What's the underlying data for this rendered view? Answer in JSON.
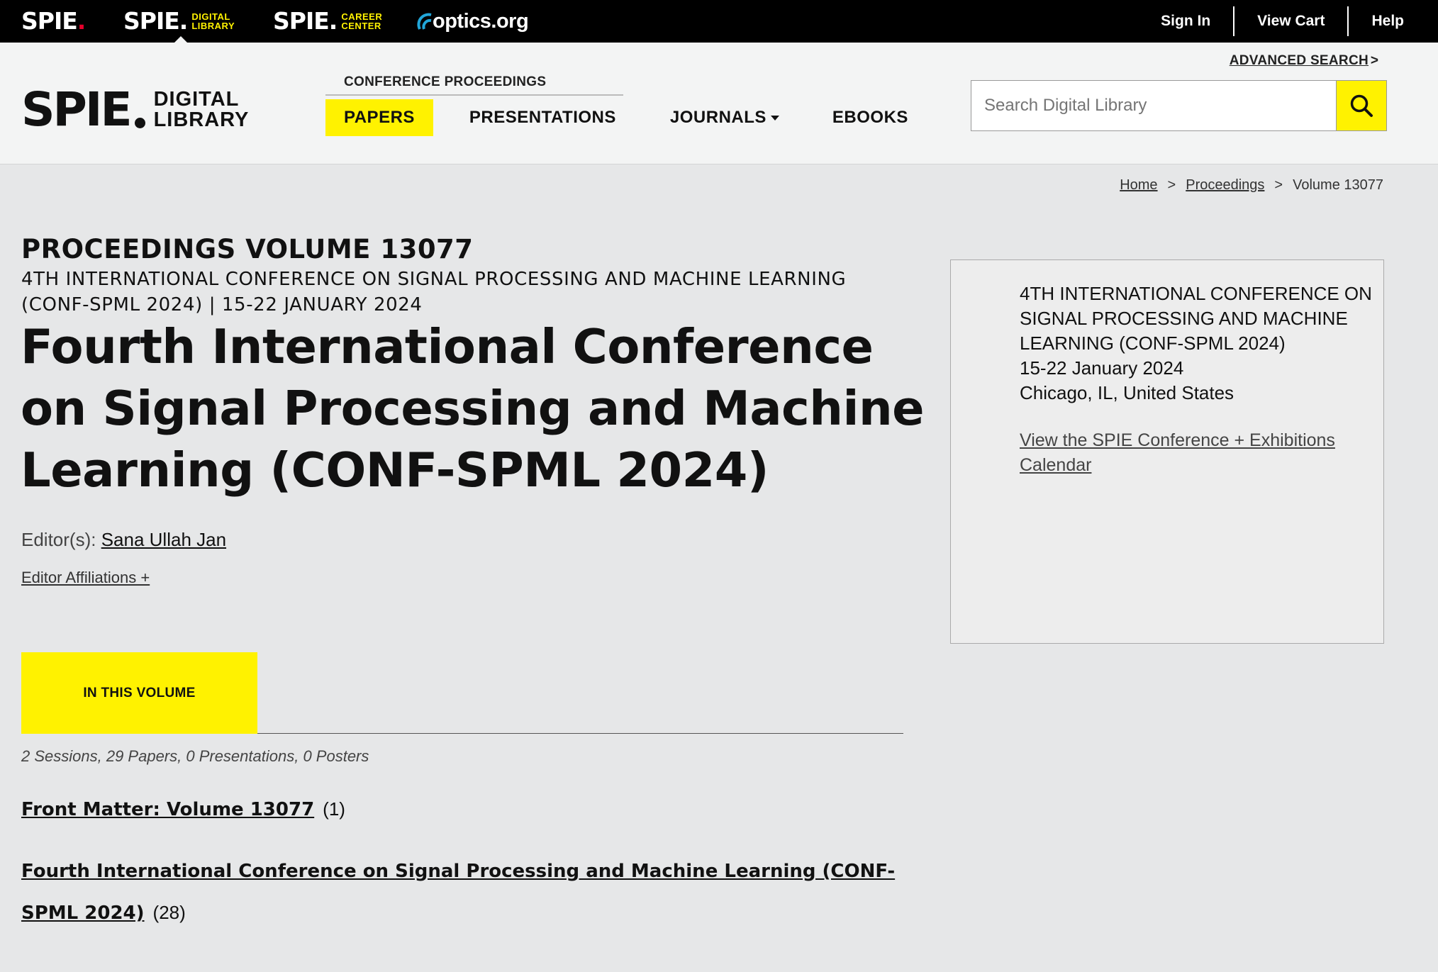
{
  "topbar": {
    "brand_spie": "SPIE",
    "brand_dl": "SPIE",
    "brand_dl_sub": [
      "DIGITAL",
      "LIBRARY"
    ],
    "brand_cc": "SPIE",
    "brand_cc_sub": [
      "CAREER",
      "CENTER"
    ],
    "optics": "optics.org",
    "links": [
      "Sign In",
      "View Cart",
      "Help"
    ]
  },
  "header": {
    "logo_word": "SPIE",
    "logo_sub": [
      "DIGITAL",
      "LIBRARY"
    ],
    "section_label": "CONFERENCE PROCEEDINGS",
    "tabs": [
      "PAPERS",
      "PRESENTATIONS",
      "JOURNALS",
      "EBOOKS"
    ],
    "advanced_search": "ADVANCED SEARCH",
    "advanced_search_gt": ">",
    "search_placeholder": "Search Digital Library"
  },
  "breadcrumb": {
    "items": [
      "Home",
      "Proceedings",
      "Volume 13077"
    ],
    "separator": ">"
  },
  "volume": {
    "heading": "PROCEEDINGS VOLUME 13077",
    "conference_line": "4TH INTERNATIONAL CONFERENCE ON SIGNAL PROCESSING AND MACHINE LEARNING (CONF-SPML 2024) | 15-22 JANUARY 2024",
    "title": "Fourth International Conference on Signal Processing and Machine Learning (CONF-SPML 2024)",
    "editors_label": "Editor(s):",
    "editor_name": "Sana Ullah Jan",
    "affiliations_link": "Editor Affiliations +",
    "tab_label": "IN THIS VOLUME",
    "counts": "2 Sessions, 29 Papers, 0 Presentations, 0 Posters",
    "sessions": [
      {
        "title": "Front Matter: Volume 13077",
        "count": "(1)"
      },
      {
        "title": "Fourth International Conference on Signal Processing and Machine Learning (CONF-SPML 2024)",
        "count": "(28)"
      }
    ]
  },
  "sidepanel": {
    "lines": [
      "4TH INTERNATIONAL CONFERENCE ON SIGNAL PROCESSING AND MACHINE LEARNING (CONF-SPML 2024)",
      "15-22 January 2024",
      "Chicago, IL, United States"
    ],
    "calendar_link": "View the SPIE Conference + Exhibitions Calendar"
  },
  "colors": {
    "accent": "#fff200",
    "topbar": "#000000",
    "brand_dot": "#e4002b"
  },
  "icons": {
    "search": "search-icon",
    "caret": "chevron-down-icon",
    "optics": "optics-arc-icon"
  }
}
